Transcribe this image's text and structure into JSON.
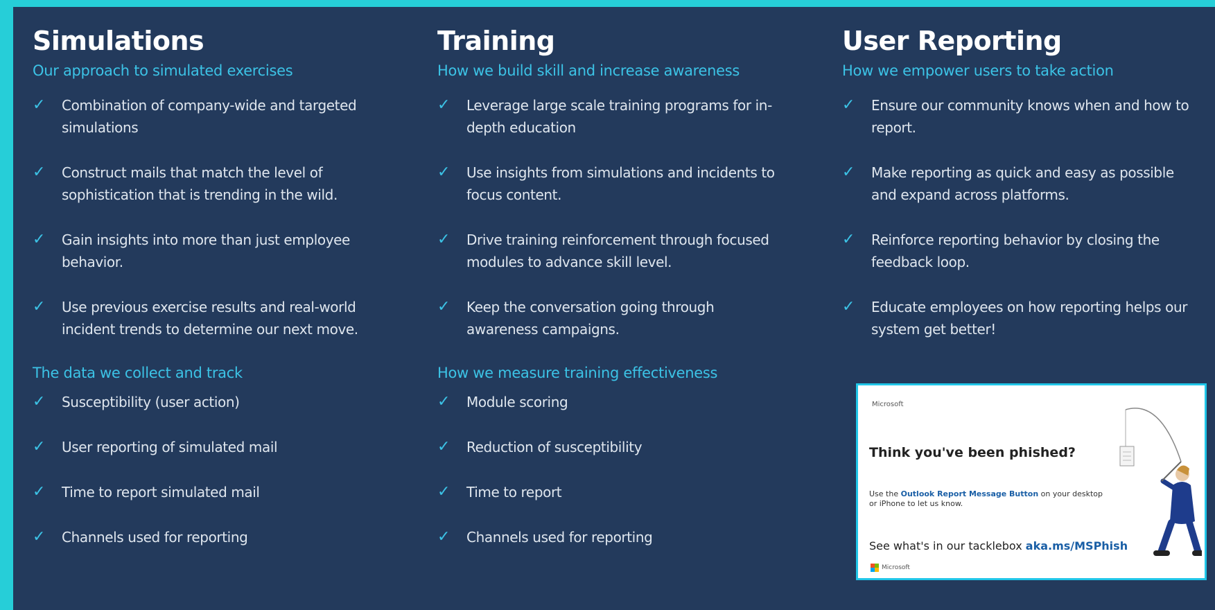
{
  "columns": [
    {
      "title": "Simulations",
      "subtitle": "Our approach to simulated exercises",
      "items": [
        "Combination of company-wide and targeted simulations",
        "Construct mails that match the level of sophistication that is trending in the wild.",
        "Gain insights into more than just employee behavior.",
        "Use previous exercise results and real-world incident trends to determine our next move."
      ],
      "subtitle2": "The data we collect and track",
      "items2": [
        "Susceptibility (user action)",
        "User reporting of simulated mail",
        "Time to report simulated mail",
        "Channels used for reporting"
      ]
    },
    {
      "title": "Training",
      "subtitle": "How we build skill and increase awareness",
      "items": [
        "Leverage large scale training programs for in-depth education",
        "Use insights from simulations and incidents to focus content.",
        "Drive training reinforcement through focused modules to advance skill level.",
        "Keep the conversation going through awareness campaigns."
      ],
      "subtitle2": "How we measure training effectiveness",
      "items2": [
        "Module scoring",
        "Reduction of susceptibility",
        "Time to report",
        "Channels used for reporting"
      ]
    },
    {
      "title": "User Reporting",
      "subtitle": "How we empower users to take action",
      "items": [
        "Ensure our community knows when and how to report.",
        "Make reporting as quick and easy as possible and expand across platforms.",
        "Reinforce reporting behavior by closing the feedback loop.",
        "Educate employees on how reporting helps our system get better!"
      ]
    }
  ],
  "check_glyph": "✓",
  "card": {
    "brand": "Microsoft",
    "headline": "Think you've been phished?",
    "body_prefix": "Use the ",
    "body_link": "Outlook Report Message Button",
    "body_suffix": " on your desktop or iPhone to let us know.",
    "footer_prefix": "See what's in our tacklebox ",
    "footer_link": "aka.ms/MSPhish",
    "footer_logo_text": "Microsoft"
  },
  "colors": {
    "background": "#233a5c",
    "accent": "#3cc3e6",
    "border": "#26ced8"
  }
}
